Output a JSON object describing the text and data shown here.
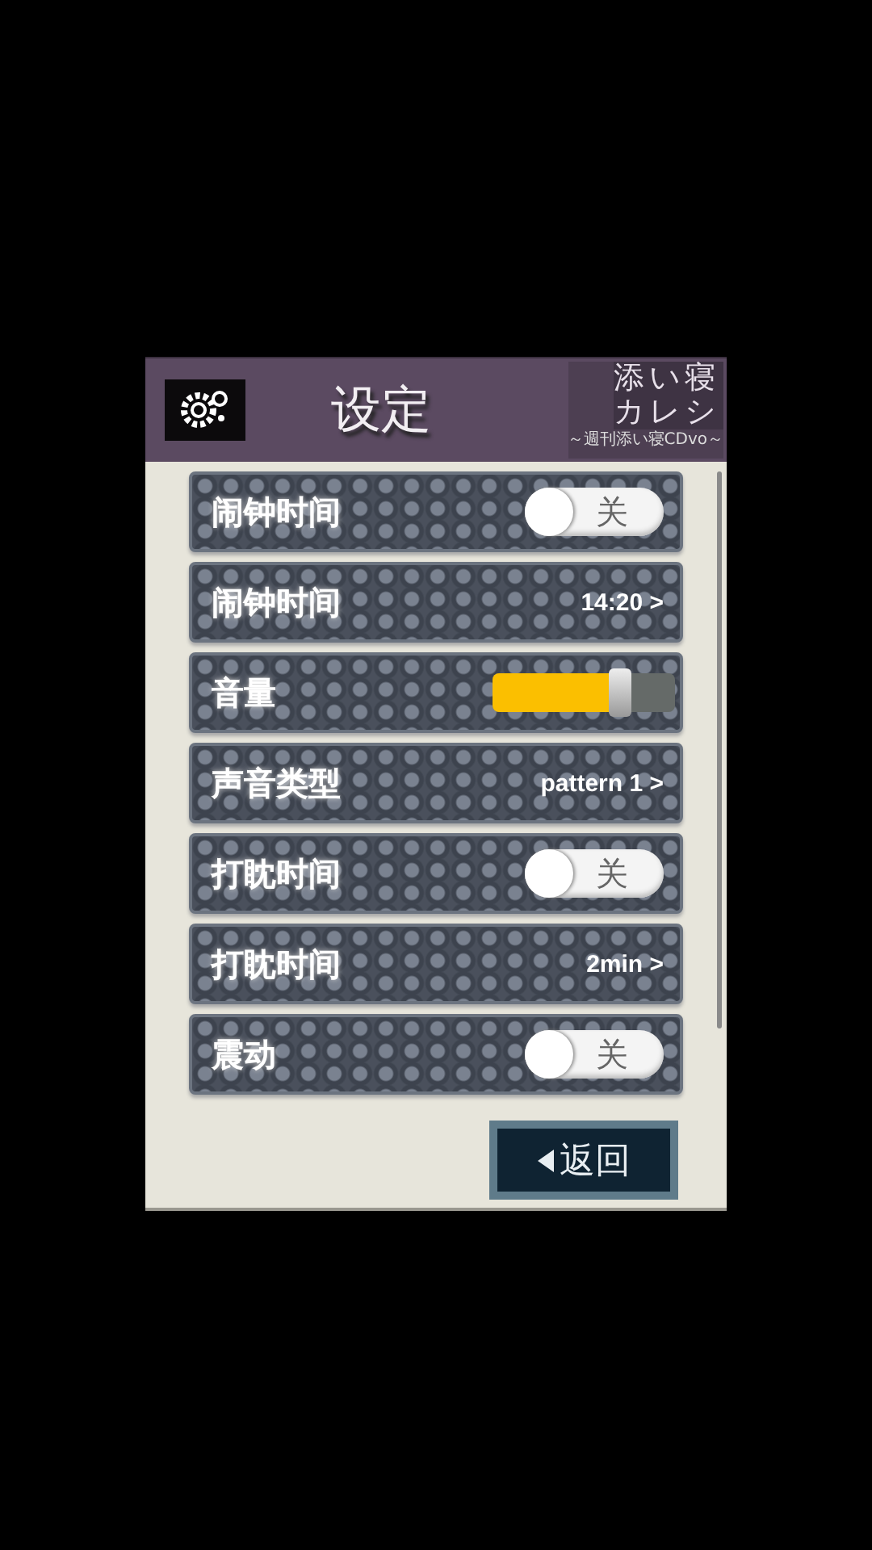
{
  "header": {
    "title": "设定",
    "logo": {
      "line_1": "添い寝",
      "line_2": "カレシ",
      "subtitle": "～週刊添い寝CDvo～"
    }
  },
  "settings": [
    {
      "kind": "toggle",
      "label": "闹钟时间",
      "on": false,
      "state_text": "关"
    },
    {
      "kind": "value",
      "label": "闹钟时间",
      "value": "14:20 >"
    },
    {
      "kind": "slider",
      "label": "音量",
      "level": 0.7
    },
    {
      "kind": "value",
      "label": "声音类型",
      "value": "pattern 1 >"
    },
    {
      "kind": "toggle",
      "label": "打眈时间",
      "on": false,
      "state_text": "关"
    },
    {
      "kind": "value",
      "label": "打眈时间",
      "value": "2min >"
    },
    {
      "kind": "toggle",
      "label": "震动",
      "on": false,
      "state_text": "关"
    }
  ],
  "back_button": {
    "label": "返回"
  }
}
